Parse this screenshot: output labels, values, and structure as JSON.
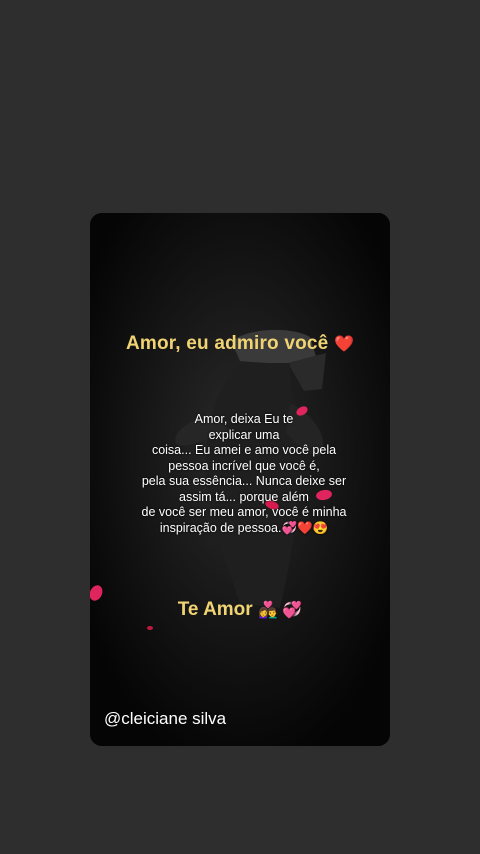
{
  "story": {
    "title": "Amor, eu admiro você",
    "title_emoji": "❤️",
    "message_lines": [
      "Amor, deixa Eu te",
      "explicar uma",
      "coisa... Eu amei e amo você pela",
      "pessoa incrível que você é,",
      "pela sua essência... Nunca deixe ser",
      "assim tá... porque além",
      "de você ser meu amor, você é minha",
      "inspiração de pessoa.💞❤️😍"
    ],
    "closing": "Te Amor",
    "closing_emoji": "👩‍❤️‍👨 💞",
    "watermark": "@cleiciane silva"
  },
  "colors": {
    "background": "#2e2e2e",
    "card": "#050505",
    "heading": "#f0d373",
    "text": "#ffffff",
    "accent": "#e0245e"
  }
}
